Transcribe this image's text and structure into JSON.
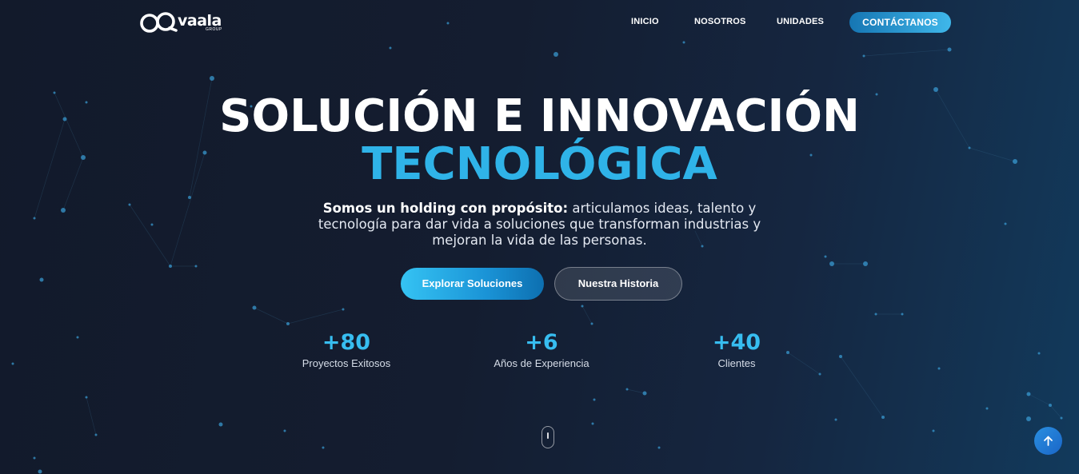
{
  "brand": {
    "name": "vaala",
    "tagline": "GROUP",
    "logo_icon": "infinity-loop-logo-icon"
  },
  "nav": {
    "items": [
      {
        "label": "INICIO"
      },
      {
        "label": "NOSOTROS"
      },
      {
        "label": "UNIDADES"
      }
    ],
    "cta_label": "CONTÁCTANOS"
  },
  "hero": {
    "title_line1": "SOLUCIÓN E INNOVACIÓN",
    "title_line2": "TECNOLÓGICA",
    "subtitle_bold": "Somos un holding con propósito:",
    "subtitle_rest": " articulamos ideas, talento y tecnología para dar vida a soluciones que transforman industrias y mejoran la vida de las personas.",
    "primary_button": "Explorar Soluciones",
    "secondary_button": "Nuestra Historia"
  },
  "stats": [
    {
      "value": "+80",
      "label": "Proyectos Exitosos"
    },
    {
      "value": "+6",
      "label": "Años de Experiencia"
    },
    {
      "value": "+40",
      "label": "Clientes"
    }
  ],
  "icons": {
    "scroll": "mouse-scroll-icon",
    "back_to_top": "arrow-up-icon"
  },
  "colors": {
    "accent": "#2fb3e8",
    "stat": "#37bdf0",
    "cta_start": "#1676b3",
    "cta_end": "#3fb7ea",
    "background": "#141d30"
  }
}
